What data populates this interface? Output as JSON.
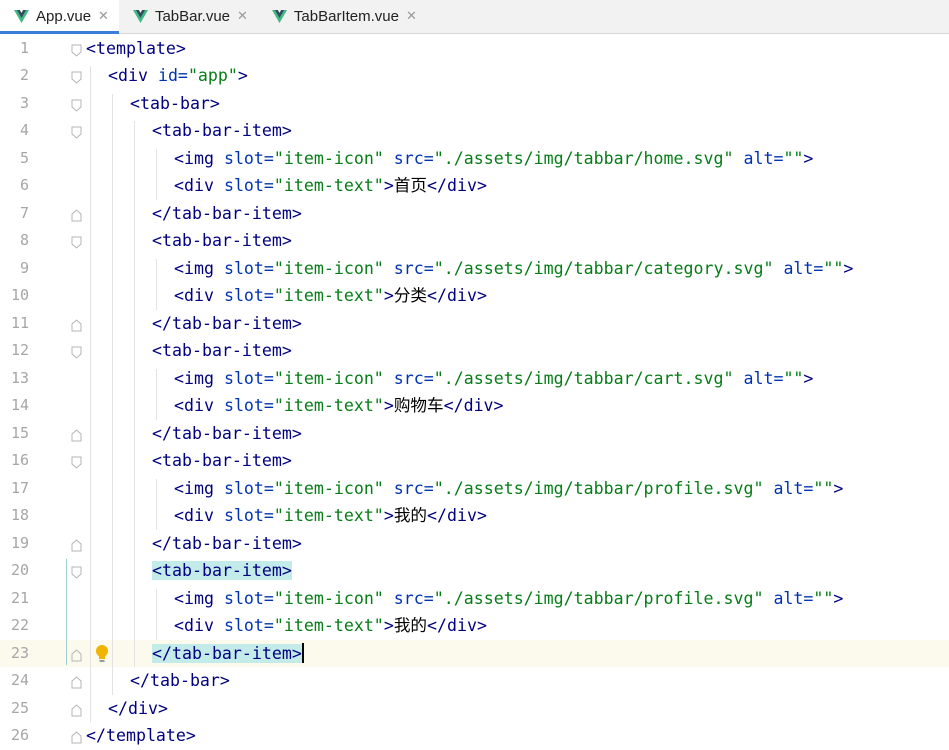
{
  "tabs": [
    {
      "label": "App.vue",
      "active": true,
      "icon": "vue-icon"
    },
    {
      "label": "TabBar.vue",
      "active": false,
      "icon": "vue-icon"
    },
    {
      "label": "TabBarItem.vue",
      "active": false,
      "icon": "vue-icon"
    }
  ],
  "close_glyph": "✕",
  "colors": {
    "tag": "#000080",
    "attribute": "#0033b3",
    "string": "#067d17",
    "line_number": "#a6a6a6",
    "current_line": "#fcfaed",
    "bracket_highlight": "#c3ebe9",
    "active_tab_underline": "#3d7fd8",
    "vue_green": "#41b883",
    "vue_dark": "#35495e",
    "bulb": "#f0b400"
  },
  "editor": {
    "current_line": 23,
    "lines": [
      {
        "n": "1",
        "indent": 0,
        "parts": [
          {
            "t": "<template>",
            "c": "tag"
          }
        ]
      },
      {
        "n": "2",
        "indent": 1,
        "parts": [
          {
            "t": "<div ",
            "c": "tag"
          },
          {
            "t": "id=",
            "c": "attr"
          },
          {
            "t": "\"app\"",
            "c": "str"
          },
          {
            "t": ">",
            "c": "tag"
          }
        ]
      },
      {
        "n": "3",
        "indent": 2,
        "parts": [
          {
            "t": "<tab-bar>",
            "c": "tag"
          }
        ]
      },
      {
        "n": "4",
        "indent": 3,
        "parts": [
          {
            "t": "<tab-bar-item>",
            "c": "tag"
          }
        ]
      },
      {
        "n": "5",
        "indent": 4,
        "parts": [
          {
            "t": "<img ",
            "c": "tag"
          },
          {
            "t": "slot=",
            "c": "attr"
          },
          {
            "t": "\"item-icon\" ",
            "c": "str"
          },
          {
            "t": "src=",
            "c": "attr"
          },
          {
            "t": "\"./assets/img/tabbar/home.svg\" ",
            "c": "str"
          },
          {
            "t": "alt=",
            "c": "attr"
          },
          {
            "t": "\"\"",
            "c": "str"
          },
          {
            "t": ">",
            "c": "tag"
          }
        ]
      },
      {
        "n": "6",
        "indent": 4,
        "parts": [
          {
            "t": "<div ",
            "c": "tag"
          },
          {
            "t": "slot=",
            "c": "attr"
          },
          {
            "t": "\"item-text\"",
            "c": "str"
          },
          {
            "t": ">",
            "c": "tag"
          },
          {
            "t": "首页",
            "c": "cn"
          },
          {
            "t": "</div>",
            "c": "tag"
          }
        ]
      },
      {
        "n": "7",
        "indent": 3,
        "parts": [
          {
            "t": "</tab-bar-item>",
            "c": "tag"
          }
        ]
      },
      {
        "n": "8",
        "indent": 3,
        "parts": [
          {
            "t": "<tab-bar-item>",
            "c": "tag"
          }
        ]
      },
      {
        "n": "9",
        "indent": 4,
        "parts": [
          {
            "t": "<img ",
            "c": "tag"
          },
          {
            "t": "slot=",
            "c": "attr"
          },
          {
            "t": "\"item-icon\" ",
            "c": "str"
          },
          {
            "t": "src=",
            "c": "attr"
          },
          {
            "t": "\"./assets/img/tabbar/category.svg\" ",
            "c": "str"
          },
          {
            "t": "alt=",
            "c": "attr"
          },
          {
            "t": "\"\"",
            "c": "str"
          },
          {
            "t": ">",
            "c": "tag"
          }
        ]
      },
      {
        "n": "10",
        "indent": 4,
        "parts": [
          {
            "t": "<div ",
            "c": "tag"
          },
          {
            "t": "slot=",
            "c": "attr"
          },
          {
            "t": "\"item-text\"",
            "c": "str"
          },
          {
            "t": ">",
            "c": "tag"
          },
          {
            "t": "分类",
            "c": "cn"
          },
          {
            "t": "</div>",
            "c": "tag"
          }
        ]
      },
      {
        "n": "11",
        "indent": 3,
        "parts": [
          {
            "t": "</tab-bar-item>",
            "c": "tag"
          }
        ]
      },
      {
        "n": "12",
        "indent": 3,
        "parts": [
          {
            "t": "<tab-bar-item>",
            "c": "tag"
          }
        ]
      },
      {
        "n": "13",
        "indent": 4,
        "parts": [
          {
            "t": "<img ",
            "c": "tag"
          },
          {
            "t": "slot=",
            "c": "attr"
          },
          {
            "t": "\"item-icon\" ",
            "c": "str"
          },
          {
            "t": "src=",
            "c": "attr"
          },
          {
            "t": "\"./assets/img/tabbar/cart.svg\" ",
            "c": "str"
          },
          {
            "t": "alt=",
            "c": "attr"
          },
          {
            "t": "\"\"",
            "c": "str"
          },
          {
            "t": ">",
            "c": "tag"
          }
        ]
      },
      {
        "n": "14",
        "indent": 4,
        "parts": [
          {
            "t": "<div ",
            "c": "tag"
          },
          {
            "t": "slot=",
            "c": "attr"
          },
          {
            "t": "\"item-text\"",
            "c": "str"
          },
          {
            "t": ">",
            "c": "tag"
          },
          {
            "t": "购物车",
            "c": "cn"
          },
          {
            "t": "</div>",
            "c": "tag"
          }
        ]
      },
      {
        "n": "15",
        "indent": 3,
        "parts": [
          {
            "t": "</tab-bar-item>",
            "c": "tag"
          }
        ]
      },
      {
        "n": "16",
        "indent": 3,
        "parts": [
          {
            "t": "<tab-bar-item>",
            "c": "tag"
          }
        ]
      },
      {
        "n": "17",
        "indent": 4,
        "parts": [
          {
            "t": "<img ",
            "c": "tag"
          },
          {
            "t": "slot=",
            "c": "attr"
          },
          {
            "t": "\"item-icon\" ",
            "c": "str"
          },
          {
            "t": "src=",
            "c": "attr"
          },
          {
            "t": "\"./assets/img/tabbar/profile.svg\" ",
            "c": "str"
          },
          {
            "t": "alt=",
            "c": "attr"
          },
          {
            "t": "\"\"",
            "c": "str"
          },
          {
            "t": ">",
            "c": "tag"
          }
        ]
      },
      {
        "n": "18",
        "indent": 4,
        "parts": [
          {
            "t": "<div ",
            "c": "tag"
          },
          {
            "t": "slot=",
            "c": "attr"
          },
          {
            "t": "\"item-text\"",
            "c": "str"
          },
          {
            "t": ">",
            "c": "tag"
          },
          {
            "t": "我的",
            "c": "cn"
          },
          {
            "t": "</div>",
            "c": "tag"
          }
        ]
      },
      {
        "n": "19",
        "indent": 3,
        "parts": [
          {
            "t": "</tab-bar-item>",
            "c": "tag"
          }
        ]
      },
      {
        "n": "20",
        "indent": 3,
        "parts": [
          {
            "t": "<",
            "c": "tag hl"
          },
          {
            "t": "tab-bar-item>",
            "c": "tag hl"
          }
        ]
      },
      {
        "n": "21",
        "indent": 4,
        "parts": [
          {
            "t": "<img ",
            "c": "tag"
          },
          {
            "t": "slot=",
            "c": "attr"
          },
          {
            "t": "\"item-icon\" ",
            "c": "str"
          },
          {
            "t": "src=",
            "c": "attr"
          },
          {
            "t": "\"./assets/img/tabbar/profile.svg\" ",
            "c": "str"
          },
          {
            "t": "alt=",
            "c": "attr"
          },
          {
            "t": "\"\"",
            "c": "str"
          },
          {
            "t": ">",
            "c": "tag"
          }
        ]
      },
      {
        "n": "22",
        "indent": 4,
        "parts": [
          {
            "t": "<div ",
            "c": "tag"
          },
          {
            "t": "slot=",
            "c": "attr"
          },
          {
            "t": "\"item-text\"",
            "c": "str"
          },
          {
            "t": ">",
            "c": "tag"
          },
          {
            "t": "我的",
            "c": "cn"
          },
          {
            "t": "</div>",
            "c": "tag"
          }
        ]
      },
      {
        "n": "23",
        "indent": 3,
        "parts": [
          {
            "t": "</tab-bar-item>",
            "c": "tag hl"
          }
        ]
      },
      {
        "n": "24",
        "indent": 2,
        "parts": [
          {
            "t": "</tab-bar>",
            "c": "tag"
          }
        ]
      },
      {
        "n": "25",
        "indent": 1,
        "parts": [
          {
            "t": "</div>",
            "c": "tag"
          }
        ]
      },
      {
        "n": "26",
        "indent": 0,
        "parts": [
          {
            "t": "</template>",
            "c": "tag"
          }
        ]
      }
    ]
  }
}
